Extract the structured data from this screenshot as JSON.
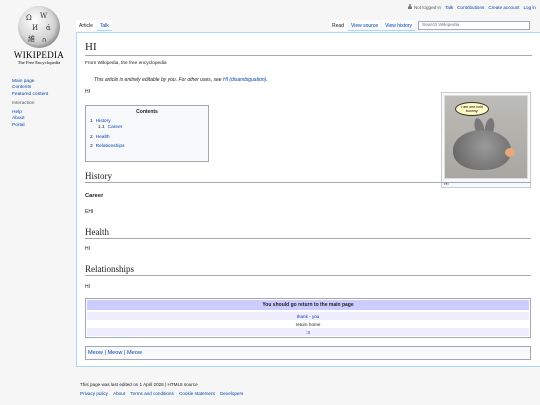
{
  "personal": {
    "not_logged_in": "Not logged in",
    "talk": "Talk",
    "contributions": "Contributions",
    "create_account": "Create account",
    "log_in": "Log in"
  },
  "logo": {
    "wordmark": "WIKIPEDIA",
    "tagline": "The Free Encyclopedia"
  },
  "sidebar": {
    "nav": [
      "Main page",
      "Contents",
      "Featured content"
    ],
    "interaction_heading": "Interaction",
    "interaction": [
      "Help",
      "About",
      "Portal"
    ]
  },
  "tabs": {
    "article": "Article",
    "talk": "Talk",
    "read": "Read",
    "view_source": "View source",
    "view_history": "View history"
  },
  "search": {
    "placeholder": "Search Wikipedia"
  },
  "article": {
    "title": "HI",
    "tagline": "From Wikipedia, the free encyclopedia",
    "hatnote_text": "This article is entirely editable by you. For other uses, see ",
    "hatnote_link": "HI (disambiguation)",
    "hatnote_end": ".",
    "lead": "HI"
  },
  "toc": {
    "title": "Contents",
    "items": [
      {
        "num": "1",
        "label": "History"
      },
      {
        "num": "1.1",
        "label": "Career"
      },
      {
        "num": "2",
        "label": "Health"
      },
      {
        "num": "3",
        "label": "Relationships"
      }
    ]
  },
  "thumb": {
    "bubble": "I am one cold bunnny.",
    "caption": "HI"
  },
  "sections": {
    "history": "History",
    "career": "Career",
    "career_text": "EHI",
    "health": "Health",
    "health_text": "HI",
    "relationships": "Relationships",
    "relationships_text": "HI"
  },
  "navbox": {
    "title": "You should go return to the main page",
    "rows": [
      "thank - you",
      "return home",
      ":3"
    ]
  },
  "meow": "Meow | Meow | Meow",
  "footer": {
    "last_edited": "This page was last edited on 1 April 2026 | HTML5 source",
    "links": [
      "Privacy policy",
      "About",
      "Terms and conditions",
      "Cookie statement",
      "Developers"
    ]
  },
  "colors": {
    "link": "#0645ad",
    "navbox_title": "#ccccff",
    "border": "#a2a9b1"
  }
}
